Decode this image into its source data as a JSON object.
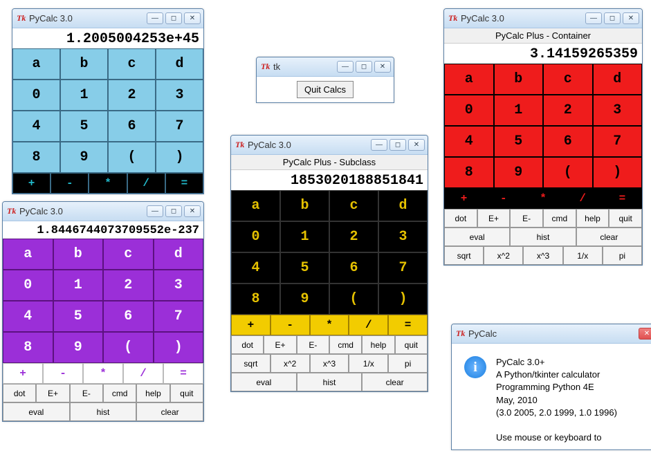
{
  "app_title": "PyCalc 3.0",
  "letters": [
    "a",
    "b",
    "c",
    "d"
  ],
  "digits": [
    "0",
    "1",
    "2",
    "3",
    "4",
    "5",
    "6",
    "7",
    "8",
    "9",
    "(",
    ")"
  ],
  "ops": [
    "+",
    "-",
    "*",
    "/",
    "="
  ],
  "row_cmd": [
    "dot",
    "E+",
    "E-",
    "cmd",
    "help",
    "quit"
  ],
  "row_eval": [
    "eval",
    "hist",
    "clear"
  ],
  "row_sci": [
    "sqrt",
    "x^2",
    "x^3",
    "1/x",
    "pi"
  ],
  "w_blue": {
    "display": "1.2005004253e+45"
  },
  "w_purple": {
    "display": "1.8446744073709552e-237"
  },
  "w_quit": {
    "title": "tk",
    "btn": "Quit Calcs"
  },
  "w_sub": {
    "subtitle": "PyCalc Plus - Subclass",
    "display": "1853020188851841"
  },
  "w_cont": {
    "subtitle": "PyCalc Plus - Container",
    "display": "3.14159265359"
  },
  "w_about": {
    "title": "PyCalc",
    "body": "PyCalc 3.0+\nA Python/tkinter calculator\nProgramming Python 4E\nMay, 2010\n(3.0 2005, 2.0 1999, 1.0 1996)\n\nUse mouse or keyboard to"
  }
}
